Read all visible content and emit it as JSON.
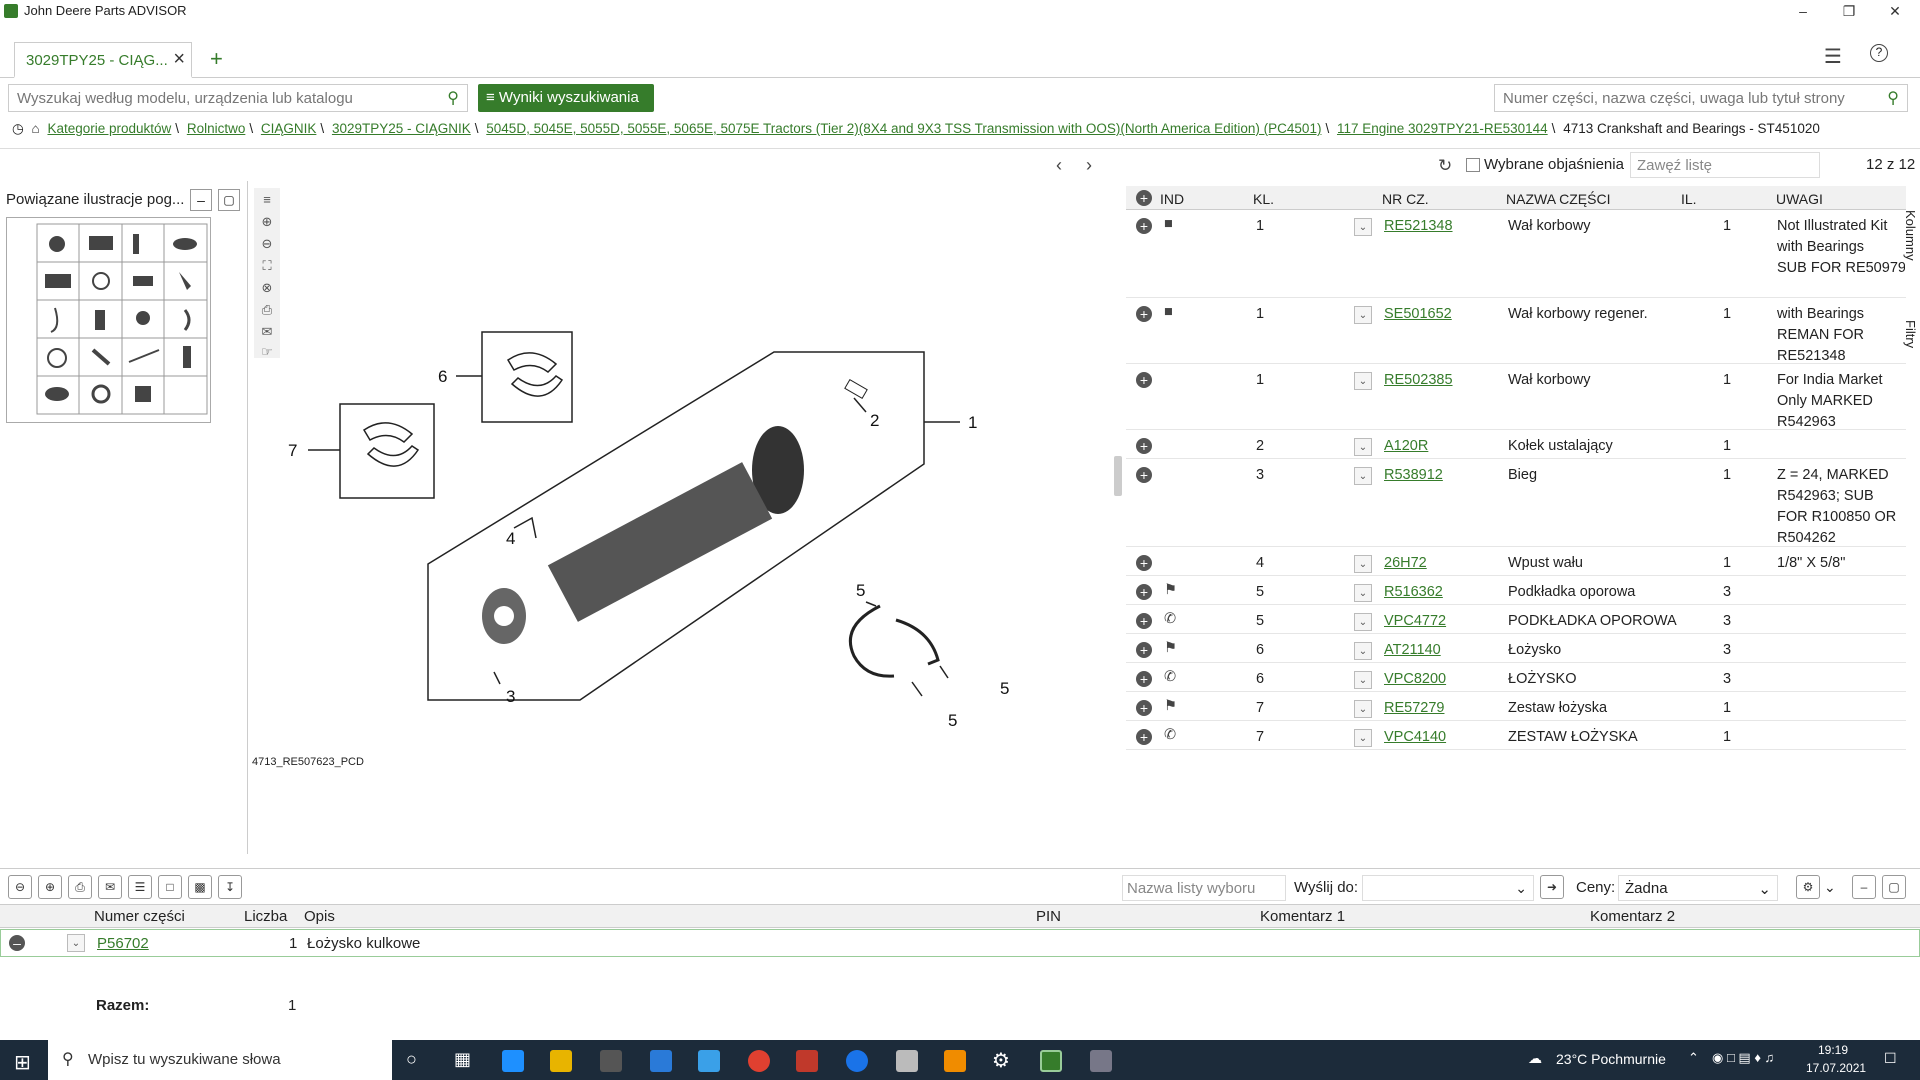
{
  "window": {
    "title": "John Deere Parts ADVISOR"
  },
  "tabs": [
    {
      "label": "3029TPY25 - CIĄG..."
    }
  ],
  "search": {
    "placeholder": "Wyszukaj według modelu, urządzenia lub katalogu",
    "results_button": "Wyniki wyszukiwania",
    "parts_placeholder": "Numer części, nazwa części, uwaga lub tytuł strony"
  },
  "breadcrumb": [
    "Kategorie produktów",
    "Rolnictwo",
    "CIĄGNIK",
    "3029TPY25 - CIĄGNIK",
    "5045D, 5045E, 5055D, 5055E, 5065E, 5075E Tractors (Tier 2)(8X4 and 9X3 TSS Transmission with OOS)(North America Edition) (PC4501)",
    "117 Engine 3029TPY21-RE530144",
    "4713 Crankshaft and Bearings - ST451020"
  ],
  "left_panel": {
    "title": "Powiązane ilustracje pog..."
  },
  "diagram": {
    "caption": "4713_RE507623_PCD",
    "callouts": [
      "1",
      "2",
      "3",
      "4",
      "5",
      "5",
      "5",
      "6",
      "7"
    ]
  },
  "parts_panel": {
    "explanations_label": "Wybrane objaśnienia",
    "filter_placeholder": "Zawęź listę",
    "count": "12 z 12",
    "side_tabs": [
      "Kolumny",
      "Filtry"
    ],
    "columns": [
      "IND",
      "KL.",
      "NR CZ.",
      "NAZWA CZĘŚCI",
      "IL.",
      "UWAGI"
    ],
    "rows": [
      {
        "kl": "1",
        "nr": "RE521348",
        "name": "Wał korbowy",
        "il": "1",
        "notes": [
          "Not Illustrated Kit",
          "with Bearings",
          "SUB FOR RE50979"
        ],
        "ind": "doc"
      },
      {
        "kl": "1",
        "nr": "SE501652",
        "name": "Wał korbowy regener.",
        "il": "1",
        "notes": [
          "with Bearings",
          "REMAN FOR",
          "RE521348"
        ],
        "ind": "doc"
      },
      {
        "kl": "1",
        "nr": "RE502385",
        "name": "Wał korbowy",
        "il": "1",
        "notes": [
          "For India Market",
          "Only MARKED",
          "R542963"
        ],
        "ind": ""
      },
      {
        "kl": "2",
        "nr": "A120R",
        "name": "Kołek ustalający",
        "il": "1",
        "notes": [],
        "ind": ""
      },
      {
        "kl": "3",
        "nr": "R538912",
        "name": "Bieg",
        "il": "1",
        "notes": [
          "Z = 24, MARKED",
          "R542963; SUB",
          "FOR R100850 OR",
          "R504262"
        ],
        "ind": ""
      },
      {
        "kl": "4",
        "nr": "26H72",
        "name": "Wpust wału",
        "il": "1",
        "notes": [
          "1/8\" X 5/8\""
        ],
        "ind": ""
      },
      {
        "kl": "5",
        "nr": "R516362",
        "name": "Podkładka oporowa",
        "il": "3",
        "notes": [],
        "ind": "flag"
      },
      {
        "kl": "5",
        "nr": "VPC4772",
        "name": "PODKŁADKA OPOROWA",
        "il": "3",
        "notes": [],
        "ind": "phone"
      },
      {
        "kl": "6",
        "nr": "AT21140",
        "name": "Łożysko",
        "il": "3",
        "notes": [],
        "ind": "flag"
      },
      {
        "kl": "6",
        "nr": "VPC8200",
        "name": "ŁOŻYSKO",
        "il": "3",
        "notes": [],
        "ind": "phone"
      },
      {
        "kl": "7",
        "nr": "RE57279",
        "name": "Zestaw łożyska",
        "il": "1",
        "notes": [],
        "ind": "flag"
      },
      {
        "kl": "7",
        "nr": "VPC4140",
        "name": "ZESTAW ŁOŻYSKA",
        "il": "1",
        "notes": [],
        "ind": "phone"
      }
    ]
  },
  "pick_list": {
    "name_placeholder": "Nazwa listy wyboru",
    "send_label": "Wyślij do:",
    "prices_label": "Ceny:",
    "prices_value": "Żadna",
    "columns": [
      "Numer części",
      "Liczba",
      "Opis",
      "PIN",
      "Komentarz 1",
      "Komentarz 2"
    ],
    "rows": [
      {
        "part": "P56702",
        "qty": "1",
        "desc": "Łożysko kulkowe"
      }
    ],
    "total_label": "Razem:",
    "total_value": "1"
  },
  "taskbar": {
    "search_placeholder": "Wpisz tu wyszukiwane słowa",
    "weather": "23°C  Pochmurnie",
    "time": "19:19",
    "date": "17.07.2021"
  },
  "colors": {
    "accent": "#367c2b"
  }
}
